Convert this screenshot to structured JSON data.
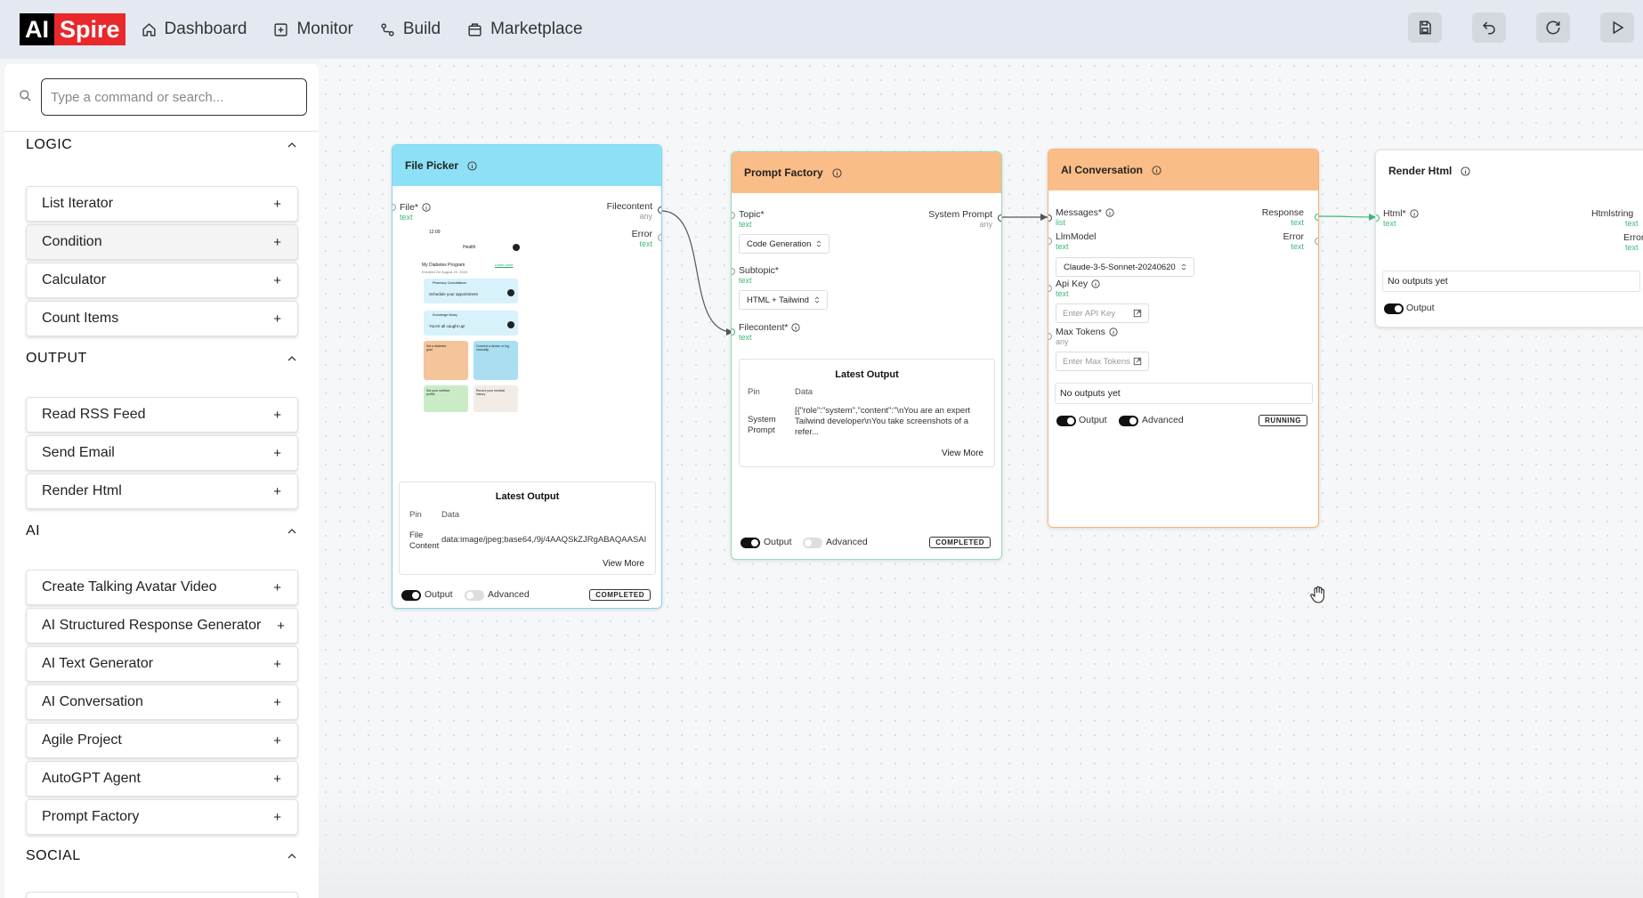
{
  "brand": {
    "part1": "AI",
    "part2": "Spire"
  },
  "nav": [
    {
      "label": "Dashboard",
      "icon": "home-icon"
    },
    {
      "label": "Monitor",
      "icon": "monitor-icon"
    },
    {
      "label": "Build",
      "icon": "build-icon"
    },
    {
      "label": "Marketplace",
      "icon": "marketplace-icon"
    }
  ],
  "toolbar": [
    "save-icon",
    "undo-icon",
    "redo-icon",
    "play-icon"
  ],
  "search": {
    "placeholder": "Type a command or search..."
  },
  "sections": {
    "logic": {
      "title": "LOGIC",
      "items": [
        "List Iterator",
        "Condition",
        "Calculator",
        "Count Items"
      ]
    },
    "output": {
      "title": "OUTPUT",
      "items": [
        "Read RSS Feed",
        "Send Email",
        "Render Html"
      ]
    },
    "ai": {
      "title": "AI",
      "items": [
        "Create Talking Avatar Video",
        "AI Structured Response Generator",
        "AI Text Generator",
        "AI Conversation",
        "Agile Project",
        "AutoGPT Agent",
        "Prompt Factory"
      ]
    },
    "social": {
      "title": "SOCIAL"
    }
  },
  "plus": "+",
  "nodes": {
    "file_picker": {
      "title": "File Picker",
      "header_color": "#8ee0f6",
      "pins": {
        "file": "File*",
        "file_type": "text",
        "filecontent": "Filecontent",
        "filecontent_type": "any",
        "error": "Error",
        "error_type": "text"
      },
      "phone": {
        "time": "12:09",
        "header": "Health",
        "program": "My Diabetes Program",
        "learn": "Learn more",
        "enrolled": "Enrolled On August 20, 2024",
        "card1_small": "Pharmacy Consultations",
        "card1": "Schedule your appointment",
        "card2_small": "Knowledge library",
        "card2": "You're all caught up!",
        "tile1": "Set a diabetes goal",
        "tile2": "Connect a device or log manually",
        "tile3": "Set your nutrition profile",
        "tile4": "Record your medical history"
      },
      "latest_output": "Latest Output",
      "col_pin": "Pin",
      "col_data": "Data",
      "row_pin": "File Content",
      "row_data": "data:image/jpeg;base64,/9j/4AAQSkZJRgABAQAASAI",
      "view_more": "View More",
      "output_label": "Output",
      "advanced_label": "Advanced",
      "status": "COMPLETED"
    },
    "prompt_factory": {
      "title": "Prompt Factory",
      "header_color": "#fbbd87",
      "pins": {
        "topic": "Topic*",
        "topic_type": "text",
        "system_prompt": "System Prompt",
        "system_prompt_type": "any",
        "subtopic": "Subtopic*",
        "subtopic_type": "text",
        "filecontent": "Filecontent*",
        "filecontent_type": "text"
      },
      "topic_value": "Code Generation",
      "subtopic_value": "HTML + Tailwind",
      "latest_output": "Latest Output",
      "col_pin": "Pin",
      "col_data": "Data",
      "row_pin": "System Prompt",
      "row_data": "[{\"role\":\"system\",\"content\":\"\\nYou are an expert Tailwind developer\\nYou take screenshots of a refer...",
      "view_more": "View More",
      "output_label": "Output",
      "advanced_label": "Advanced",
      "status": "COMPLETED"
    },
    "ai_conversation": {
      "title": "AI Conversation",
      "header_color": "#fbbd87",
      "pins": {
        "messages": "Messages*",
        "messages_type": "list",
        "response": "Response",
        "response_type": "text",
        "llmmodel": "LlmModel",
        "llmmodel_type": "text",
        "error": "Error",
        "error_type": "text",
        "api_key": "Api Key",
        "api_key_type": "text",
        "max_tokens": "Max Tokens",
        "max_tokens_type": "any"
      },
      "model_value": "Claude-3-5-Sonnet-20240620",
      "api_key_placeholder": "Enter API Key",
      "max_tokens_placeholder": "Enter Max Tokens",
      "no_outputs": "No outputs yet",
      "output_label": "Output",
      "advanced_label": "Advanced",
      "status": "RUNNING"
    },
    "render_html": {
      "title": "Render Html",
      "header_color": "#ffffff",
      "pins": {
        "html": "Html*",
        "html_type": "text",
        "htmlstring": "Htmlstring",
        "htmlstring_type": "text",
        "error": "Error",
        "error_type": "text"
      },
      "no_outputs": "No outputs yet",
      "output_label": "Output"
    }
  }
}
